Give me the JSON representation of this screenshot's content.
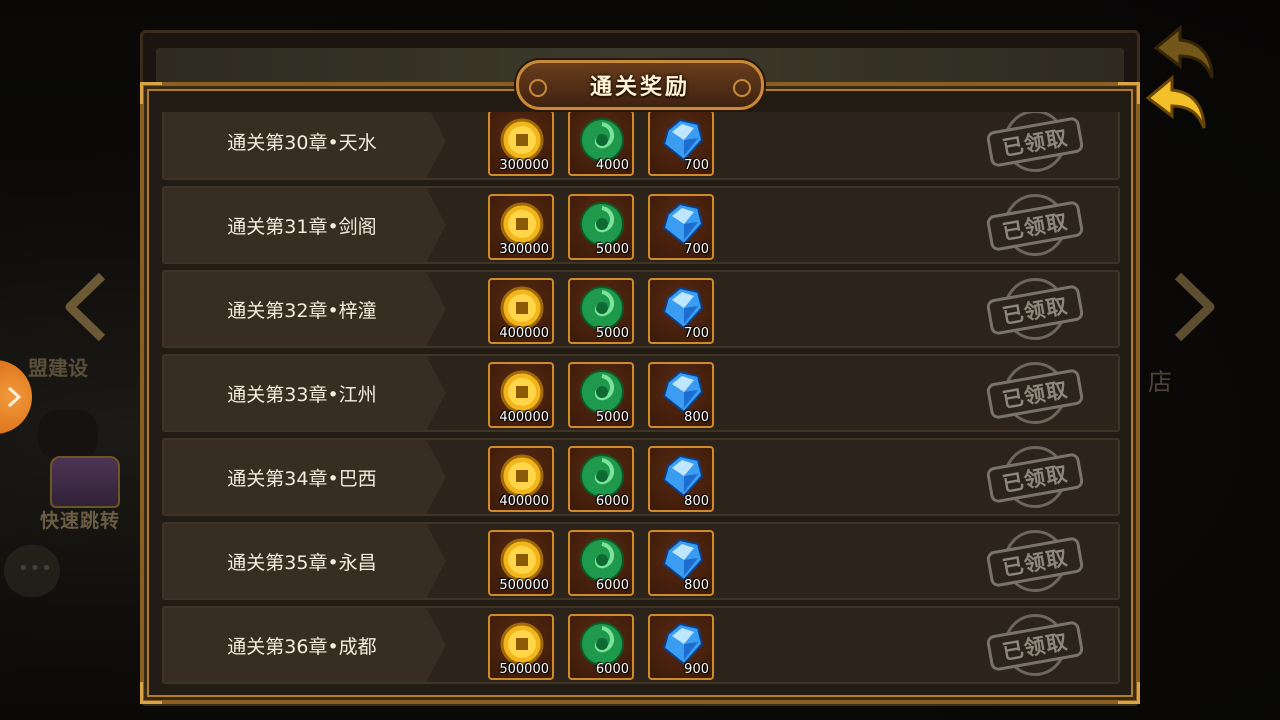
{
  "panel": {
    "title": "通关奖励"
  },
  "background": {
    "left_label": "盟建设",
    "left_label2": "快速跳转",
    "right_label": "店"
  },
  "claimed_stamp": "已领取",
  "rows": [
    {
      "label": "通关第30章•天水",
      "gold": "300000",
      "jade": "4000",
      "gem": "700",
      "status": "已领取"
    },
    {
      "label": "通关第31章•剑阁",
      "gold": "300000",
      "jade": "5000",
      "gem": "700",
      "status": "已领取"
    },
    {
      "label": "通关第32章•梓潼",
      "gold": "400000",
      "jade": "5000",
      "gem": "700",
      "status": "已领取"
    },
    {
      "label": "通关第33章•江州",
      "gold": "400000",
      "jade": "5000",
      "gem": "800",
      "status": "已领取"
    },
    {
      "label": "通关第34章•巴西",
      "gold": "400000",
      "jade": "6000",
      "gem": "800",
      "status": "已领取"
    },
    {
      "label": "通关第35章•永昌",
      "gold": "500000",
      "jade": "6000",
      "gem": "800",
      "status": "已领取"
    },
    {
      "label": "通关第36章•成都",
      "gold": "500000",
      "jade": "6000",
      "gem": "900",
      "status": "已领取"
    }
  ],
  "icons": {
    "gold": "gold-coin-icon",
    "jade": "jade-icon",
    "gem": "diamond-icon",
    "back": "back-arrow-icon",
    "prev": "chevron-left-icon",
    "next": "chevron-right-icon"
  },
  "colors": {
    "frame_gold": "#d9a445",
    "row_bg": "#2c241b",
    "item_border": "#d08a2a",
    "side_tab": "#e07a22"
  }
}
